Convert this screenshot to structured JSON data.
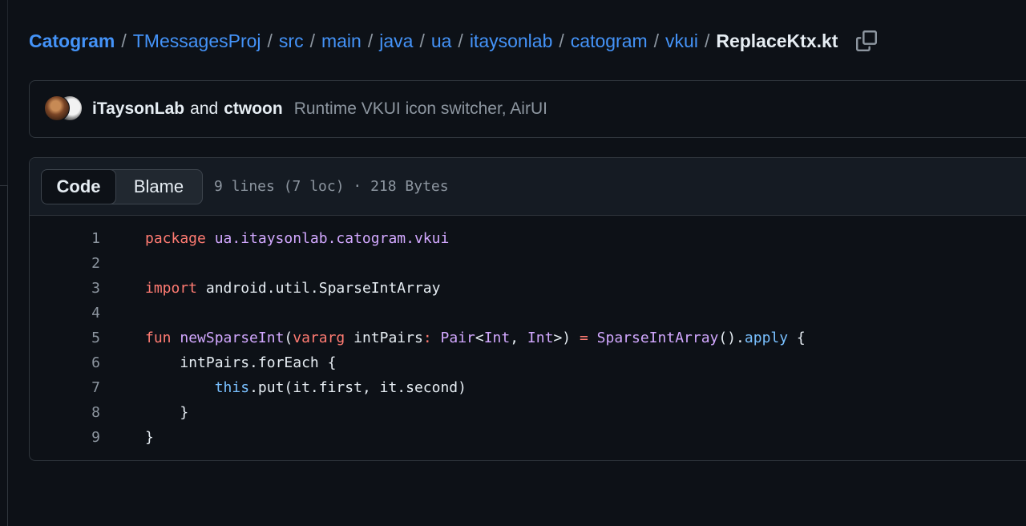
{
  "breadcrumb": {
    "items": [
      "Catogram",
      "TMessagesProj",
      "src",
      "main",
      "java",
      "ua",
      "itaysonlab",
      "catogram",
      "vkui"
    ],
    "current": "ReplaceKtx.kt",
    "separator": "/"
  },
  "commit": {
    "author1": "iTaysonLab",
    "and": "and",
    "author2": "ctwoon",
    "message": "Runtime VKUI icon switcher, AirUI"
  },
  "file": {
    "tabs": [
      "Code",
      "Blame"
    ],
    "meta": "9 lines (7 loc) · 218 Bytes"
  },
  "code": {
    "line_numbers": [
      "1",
      "2",
      "3",
      "4",
      "5",
      "6",
      "7",
      "8",
      "9"
    ],
    "l1": {
      "kw": "package",
      "pkg": "ua.itaysonlab.catogram.vkui"
    },
    "l3": {
      "kw": "import",
      "rest": "android.util.SparseIntArray"
    },
    "l5": {
      "kw": "fun",
      "name": "newSparseInt",
      "paren": "(",
      "vararg": "vararg",
      "param": "intPairs",
      "colon": ":",
      "type": "Pair",
      "lt": "<",
      "t1": "Int",
      "comma": ", ",
      "t2": "Int",
      "gt": ">)",
      "eq": "=",
      "ctor": "SparseIntArray",
      "call": "().",
      "apply": "apply",
      "brace": "{"
    },
    "l6": "intPairs.forEach {",
    "l7": {
      "this": "this",
      "rest": ".put(it.first, it.second)"
    },
    "l8": "}",
    "l9": "}"
  },
  "colors": {
    "background": "#0d1117",
    "link": "#4493f8",
    "keyword": "#ff7b72",
    "entity": "#d2a8ff",
    "constant": "#79c0ff",
    "muted": "#8d96a0"
  },
  "icons": {
    "copy": "copy-icon"
  }
}
